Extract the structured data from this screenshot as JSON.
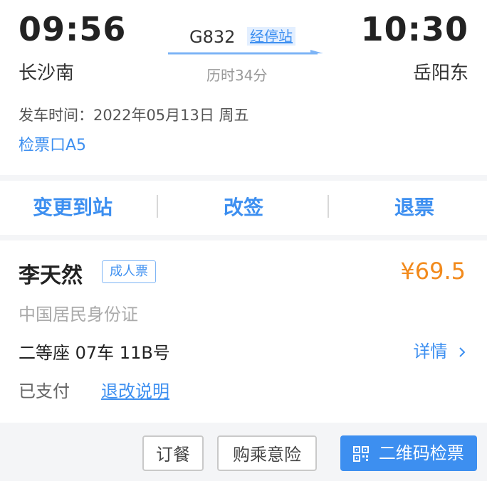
{
  "trip": {
    "departure_time": "09:56",
    "departure_station": "长沙南",
    "arrival_time": "10:30",
    "arrival_station": "岳阳东",
    "train_number": "G832",
    "stops_link": "经停站",
    "duration": "历时34分",
    "departure_date": "发车时间：2022年05月13日 周五",
    "ticket_gate": "检票口A5"
  },
  "actions": {
    "change_destination": "变更到站",
    "reschedule": "改签",
    "refund": "退票"
  },
  "passenger": {
    "name": "李天然",
    "ticket_type": "成人票",
    "price": "¥69.5",
    "id_type": "中国居民身份证",
    "seat": "二等座 07车 11B号",
    "detail_link": "详情",
    "payment_status": "已支付",
    "refund_rules_link": "退改说明"
  },
  "buttons": {
    "order_meal": "订餐",
    "travel_insurance": "购乘意险",
    "qr_check_in": "二维码检票"
  },
  "colors": {
    "accent": "#3d8ff0",
    "price": "#f28a1c"
  },
  "icons": {
    "arrow": "train-direction-arrow-icon",
    "chevron": "chevron-right-icon",
    "qr": "qr-code-icon"
  }
}
